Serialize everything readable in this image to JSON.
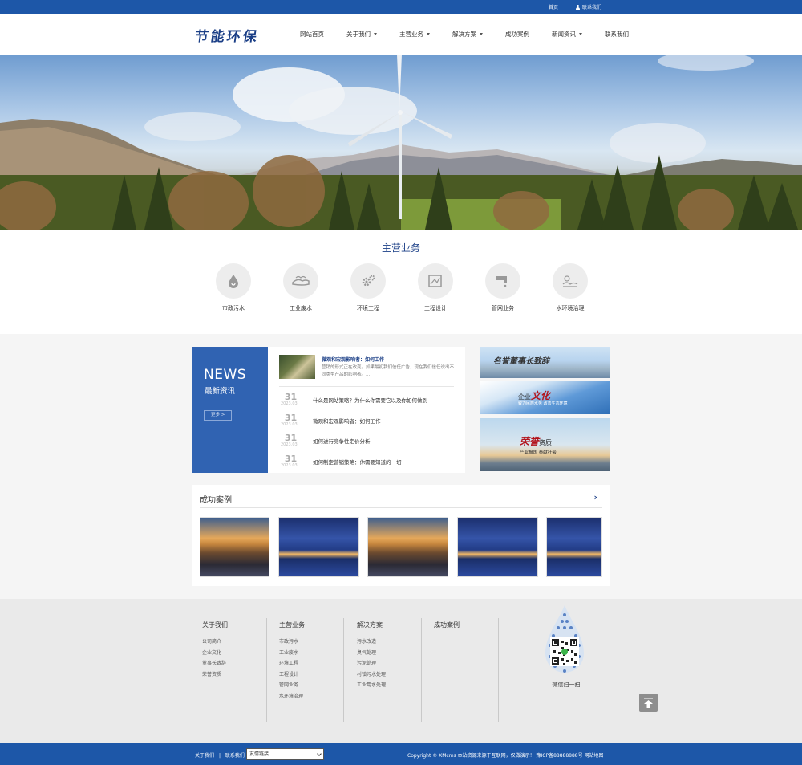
{
  "topbar": {
    "home": "首页",
    "contact": "联系我们"
  },
  "header": {
    "logo": "节能环保",
    "nav": [
      {
        "label": "网站首页",
        "dropdown": false
      },
      {
        "label": "关于我们",
        "dropdown": true
      },
      {
        "label": "主营业务",
        "dropdown": true
      },
      {
        "label": "解决方案",
        "dropdown": true
      },
      {
        "label": "成功案例",
        "dropdown": false
      },
      {
        "label": "新闻资讯",
        "dropdown": true
      },
      {
        "label": "联系我们",
        "dropdown": false
      }
    ]
  },
  "business": {
    "title": "主营业务",
    "items": [
      {
        "label": "市政污水",
        "icon": "water-drop-icon"
      },
      {
        "label": "工业废水",
        "icon": "hand-water-icon"
      },
      {
        "label": "环境工程",
        "icon": "gears-icon"
      },
      {
        "label": "工程设计",
        "icon": "blueprint-icon"
      },
      {
        "label": "管网业务",
        "icon": "faucet-icon"
      },
      {
        "label": "水环境治理",
        "icon": "landscape-icon"
      }
    ]
  },
  "news": {
    "title_en": "NEWS",
    "title_cn": "最新资讯",
    "more": "更多 >",
    "featured": {
      "title": "微观和宏观影响者：如何工作",
      "desc": "营销的形式正在改变。如果最初我们信任广告，现在我们信任说出不同类型产品的影响者。..."
    },
    "list": [
      {
        "day": "31",
        "ym": "2023.03",
        "title": "什么是网站策略？为什么你需要它以及你如何做到"
      },
      {
        "day": "31",
        "ym": "2023.03",
        "title": "微观和宏观影响者：如何工作"
      },
      {
        "day": "31",
        "ym": "2023.03",
        "title": "如何进行竞争性定价分析"
      },
      {
        "day": "31",
        "ym": "2023.03",
        "title": "如何制定营销策略：你需要知道的一切"
      }
    ]
  },
  "side_banners": {
    "b1": {
      "title": "名誉董事长",
      "suffix": "致辞"
    },
    "b2": {
      "prefix": "企业",
      "title": "文化",
      "sub": "致力民族水务  改善生态环境"
    },
    "b3": {
      "title": "荣誉",
      "suffix": "资质",
      "sub": "产业报国  奉献社会"
    }
  },
  "cases": {
    "title": "成功案例",
    "arrow": "›"
  },
  "footer": {
    "cols": [
      {
        "title": "关于我们",
        "items": [
          "公司简介",
          "企业文化",
          "董事长致辞",
          "荣誉资质"
        ]
      },
      {
        "title": "主营业务",
        "items": [
          "市政污水",
          "工业废水",
          "环境工程",
          "工程设计",
          "管网业务",
          "水环境治理"
        ]
      },
      {
        "title": "解决方案",
        "items": [
          "污水改造",
          "臭气处理",
          "污泥处理",
          "村镇污水处理",
          "工业用水处理"
        ]
      },
      {
        "title": "成功案例",
        "items": []
      }
    ],
    "qr_label": "微信扫一扫"
  },
  "bottombar": {
    "about": "关于我们",
    "sep": "|",
    "contact": "联系我们",
    "select": "友情链接",
    "copyright": "Copyright © XMcms 本站资源来源于互联网，仅做演示！  豫ICP备88888888号  网站地图"
  },
  "colors": {
    "primary": "#1d57a8",
    "news_block": "#3063b2",
    "title_blue": "#1a3e86"
  }
}
